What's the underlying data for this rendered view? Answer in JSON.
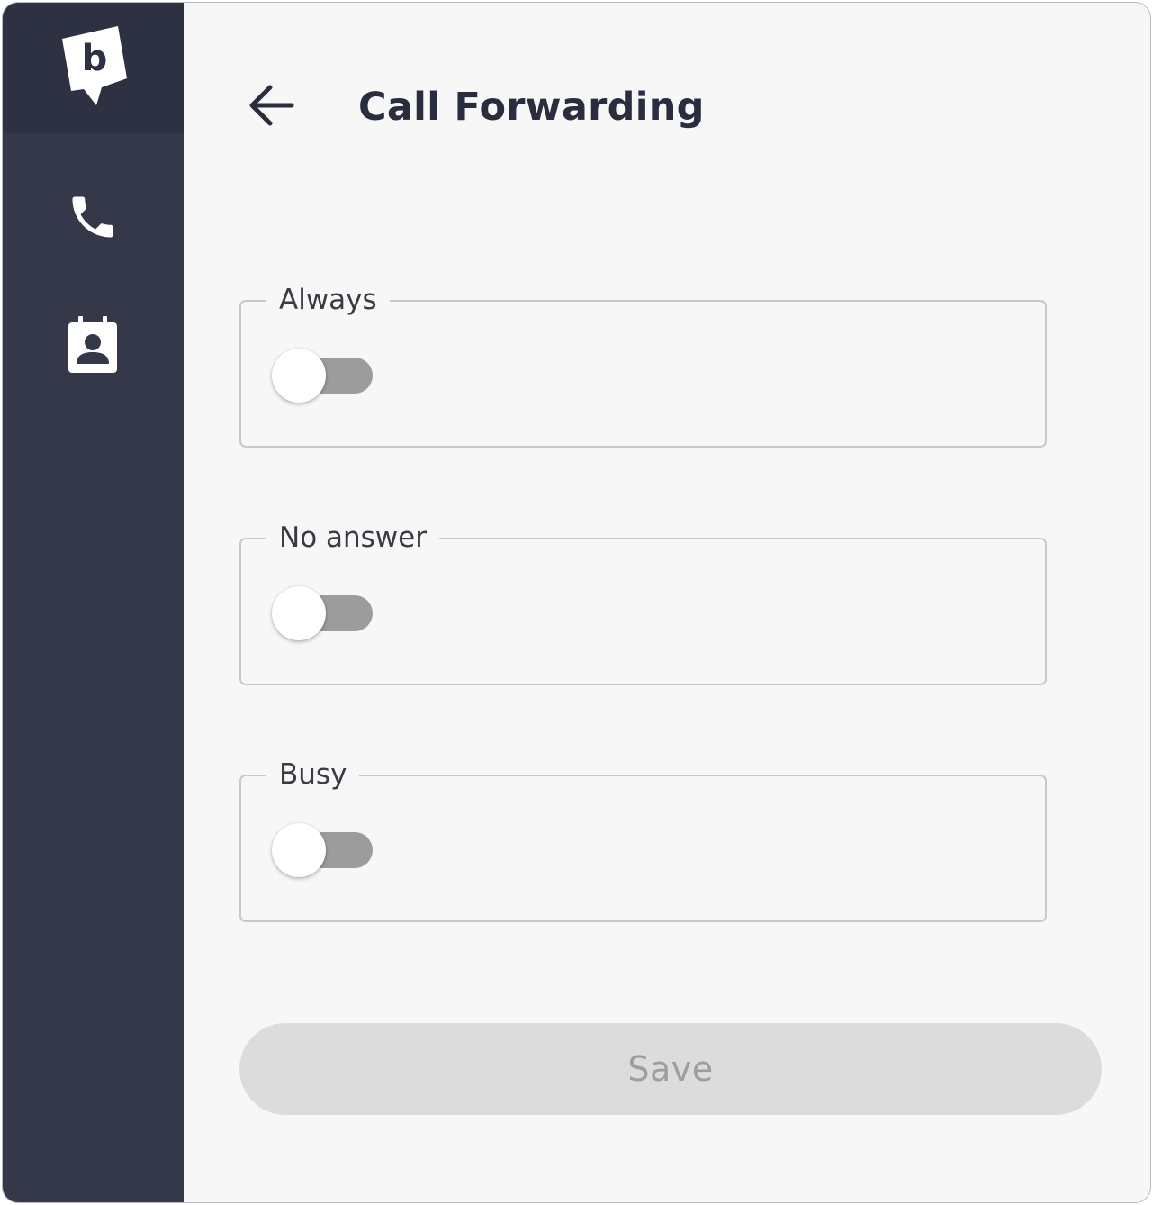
{
  "sidebar": {
    "logo_icon": "brand-logo-icon",
    "items": [
      {
        "icon": "phone-icon"
      },
      {
        "icon": "contacts-icon"
      }
    ]
  },
  "header": {
    "back_icon": "arrow-left-icon",
    "title": "Call Forwarding"
  },
  "forwarding": [
    {
      "label": "Always",
      "enabled": false
    },
    {
      "label": "No answer",
      "enabled": false
    },
    {
      "label": "Busy",
      "enabled": false
    }
  ],
  "actions": {
    "save_label": "Save",
    "save_disabled": true
  },
  "colors": {
    "sidebar_bg": "#353848",
    "logo_area_bg": "#2e3142",
    "main_bg": "#f7f7f7",
    "title": "#2a2d3e",
    "toggle_track_off": "#9c9c9c",
    "button_disabled_bg": "#dcdcdc",
    "button_disabled_text": "#9e9e9e"
  }
}
